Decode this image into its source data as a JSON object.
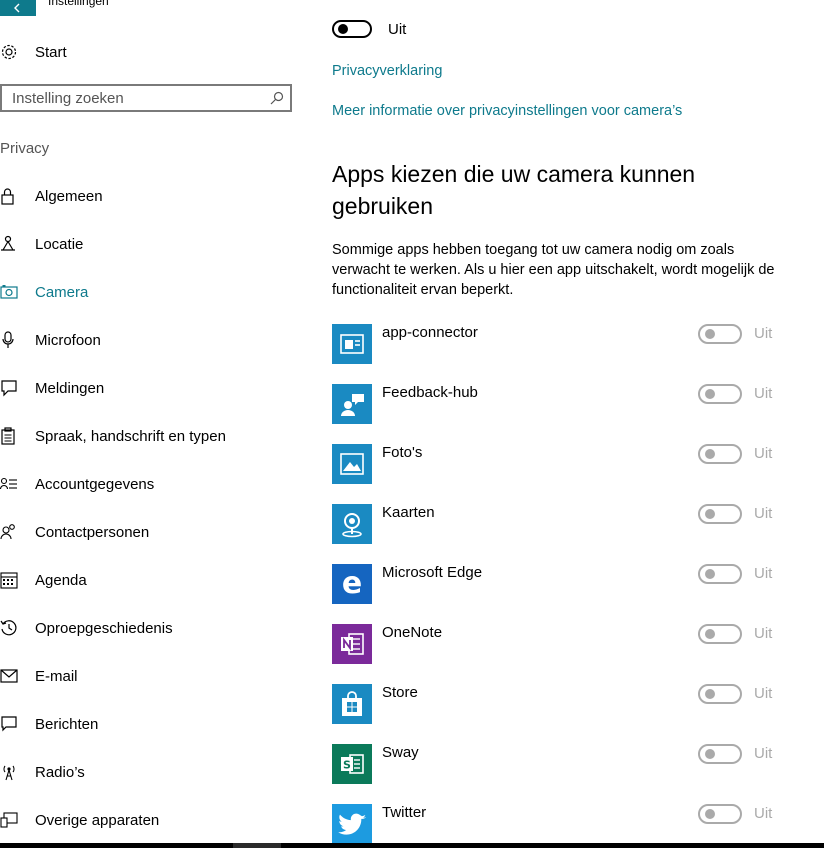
{
  "window": {
    "title": "Instellingen"
  },
  "sidebar": {
    "home_label": "Start",
    "search_placeholder": "Instelling zoeken",
    "section_label": "Privacy",
    "items": [
      {
        "label": "Algemeen",
        "icon": "lock-icon"
      },
      {
        "label": "Locatie",
        "icon": "location-icon"
      },
      {
        "label": "Camera",
        "icon": "camera-icon",
        "active": true
      },
      {
        "label": "Microfoon",
        "icon": "microphone-icon"
      },
      {
        "label": "Meldingen",
        "icon": "notification-icon"
      },
      {
        "label": "Spraak, handschrift en typen",
        "icon": "clipboard-icon"
      },
      {
        "label": "Accountgegevens",
        "icon": "account-info-icon"
      },
      {
        "label": "Contactpersonen",
        "icon": "contacts-icon"
      },
      {
        "label": "Agenda",
        "icon": "calendar-icon"
      },
      {
        "label": "Oproepgeschiedenis",
        "icon": "history-icon"
      },
      {
        "label": "E-mail",
        "icon": "mail-icon"
      },
      {
        "label": "Berichten",
        "icon": "message-icon"
      },
      {
        "label": "Radio’s",
        "icon": "radio-icon"
      },
      {
        "label": "Overige apparaten",
        "icon": "devices-icon"
      }
    ]
  },
  "main": {
    "camera_toggle_state": "Uit",
    "privacy_link": "Privacyverklaring",
    "more_info_link": "Meer informatie over privacyinstellingen voor camera’s",
    "heading": "Apps kiezen die uw camera kunnen gebruiken",
    "description": "Sommige apps hebben toegang tot uw camera nodig om zoals verwacht te werken. Als u hier een app uitschakelt, wordt mogelijk de functionaliteit ervan beperkt.",
    "apps": [
      {
        "name": "app-connector",
        "state": "Uit",
        "color": "#1a8ac2",
        "icon": "app-connector-icon"
      },
      {
        "name": "Feedback-hub",
        "state": "Uit",
        "color": "#1a8ac2",
        "icon": "feedback-hub-icon"
      },
      {
        "name": "Foto's",
        "state": "Uit",
        "color": "#1a8ac2",
        "icon": "photos-icon"
      },
      {
        "name": "Kaarten",
        "state": "Uit",
        "color": "#1a8ac2",
        "icon": "maps-icon"
      },
      {
        "name": "Microsoft Edge",
        "state": "Uit",
        "color": "#1565c0",
        "icon": "edge-icon"
      },
      {
        "name": "OneNote",
        "state": "Uit",
        "color": "#7b2a9a",
        "icon": "onenote-icon"
      },
      {
        "name": "Store",
        "state": "Uit",
        "color": "#1a8ac2",
        "icon": "store-icon"
      },
      {
        "name": "Sway",
        "state": "Uit",
        "color": "#0b7a5a",
        "icon": "sway-icon"
      },
      {
        "name": "Twitter",
        "state": "Uit",
        "color": "#1d9be0",
        "icon": "twitter-icon"
      }
    ]
  },
  "colors": {
    "accent": "#0e7a8c",
    "toggle_off": "#aaaaaa"
  }
}
